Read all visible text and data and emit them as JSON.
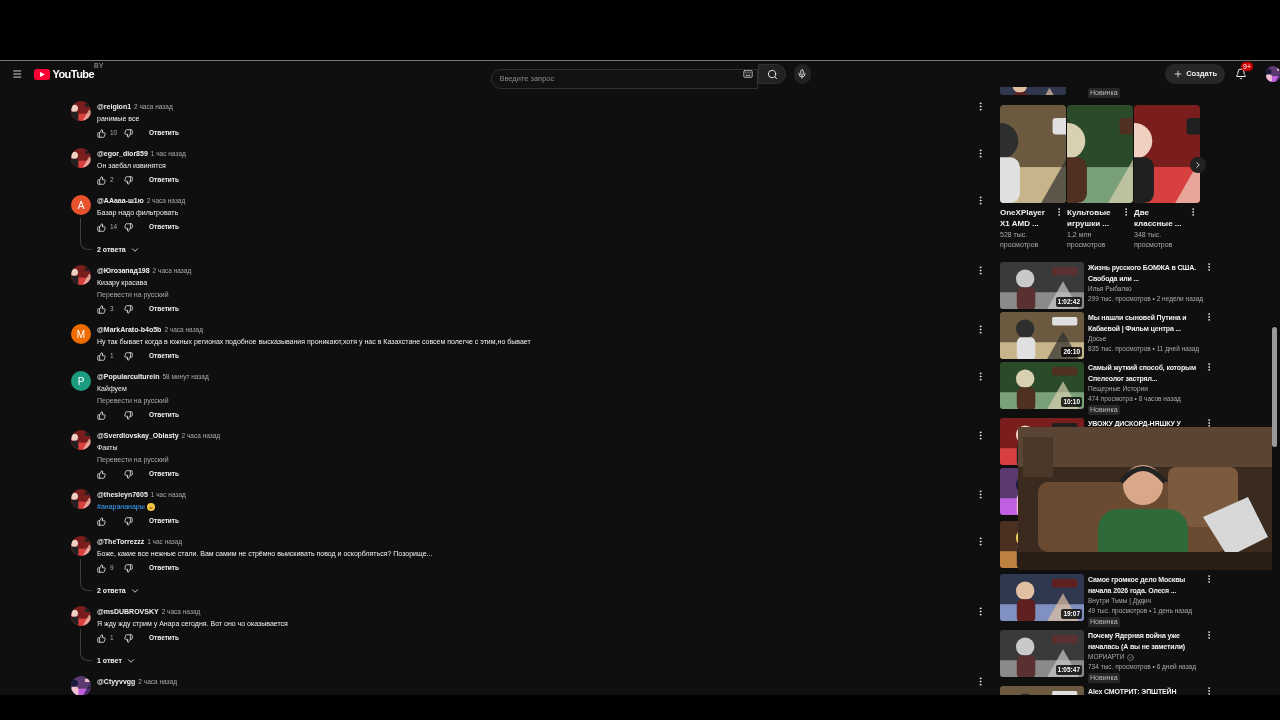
{
  "header": {
    "logo_text": "YouTube",
    "region": "BY",
    "search": {
      "placeholder": "Введите запрос"
    },
    "create_label": "Создать",
    "notifications_badge": "9+"
  },
  "comments": [
    {
      "author": "@reigion1",
      "time": "2 часа назад",
      "text": "ранимые все",
      "likes": "10",
      "reply_label": "Ответить"
    },
    {
      "author": "@egor_dior859",
      "time": "1 час назад",
      "text": "Он заебал извинятся",
      "likes": "2",
      "reply_label": "Ответить"
    },
    {
      "author": "@AAaaa-ш1ю",
      "time": "2 часа назад",
      "text": "Базар надо фильтровать",
      "likes": "14",
      "reply_label": "Ответить",
      "replies_label": "2 ответа",
      "avatar": {
        "kind": "letter",
        "letter": "A",
        "color": "#e8532e"
      }
    },
    {
      "author": "@Югозапад198",
      "time": "2 часа назад",
      "text": "Кизару красава",
      "translate": "Перевести на русский",
      "likes": "3",
      "reply_label": "Ответить"
    },
    {
      "author": "@MarkArato-b4o5b",
      "time": "2 часа назад",
      "text": "Ну так бывает когда в южных регионах подобное высказывания проникают,хотя у нас в Казахстане совсем полегче с этим,но бывает",
      "likes": "1",
      "reply_label": "Ответить",
      "avatar": {
        "kind": "letter",
        "letter": "M",
        "color": "#ef6c00"
      }
    },
    {
      "author": "@Popularculturein",
      "time": "58 минут назад",
      "text": "Кайфуем",
      "translate": "Перевести на русский",
      "reply_label": "Ответить",
      "avatar": {
        "kind": "letter",
        "letter": "P",
        "color": "#1b9b80"
      }
    },
    {
      "author": "@Sverdlovskay_Oblasty",
      "time": "2 часа назад",
      "text": "Факты",
      "translate": "Перевести на русский",
      "reply_label": "Ответить"
    },
    {
      "author": "@thesieyn7605",
      "time": "1 час назад",
      "text": "#анарананары",
      "hashtag": true,
      "emoji": true,
      "reply_label": "Ответить"
    },
    {
      "author": "@TheTorrezzz",
      "time": "1 час назад",
      "text": "Боже, какие все нежные стали. Вам самим не стрёмно выискивать повод и оскорбляться? Позорище...",
      "likes": "9",
      "reply_label": "Ответить",
      "replies_label": "2 ответа"
    },
    {
      "author": "@msDUBROVSKY",
      "time": "2 часа назад",
      "text": "Я жду жду стрим у Анара сегодня. Вот оно чо оказывается",
      "likes": "1",
      "reply_label": "Ответить",
      "replies_label": "1 ответ"
    },
    {
      "author": "@Ctyyvvgg",
      "time": "2 часа назад"
    }
  ],
  "sidebar": {
    "top_partial": {
      "badge": "Новинка"
    },
    "shorts": [
      {
        "title": "OneXPlayer X1 AMD ...",
        "views": "528 тыс. просмотров"
      },
      {
        "title": "Культовые игрушки ...",
        "views": "1,2 млн просмотров"
      },
      {
        "title": "Две классные ...",
        "views": "348 тыс. просмотров"
      }
    ],
    "videos": [
      {
        "kind": "video",
        "title": "Жизнь русского БОМЖА в США. Свобода или ...",
        "channel": "Илья Рыбалко",
        "meta": "299 тыс. просмотров • 2 недели назад",
        "duration": "1:02:42"
      },
      {
        "kind": "video",
        "title": "Мы нашли сыновей Путина и Кабаевой | Фильм центра ...",
        "channel": "Досье",
        "meta": "835 тыс. просмотров • 11 дней назад",
        "duration": "26:10"
      },
      {
        "kind": "video",
        "title": "Самый жуткий способ, которым Спелеолог застрял...",
        "channel": "Пещерные Истории",
        "meta": "474 просмотра • 8 часов назад",
        "duration": "10:10",
        "badge": "Новинка"
      },
      {
        "kind": "video",
        "title": "УВОЖУ ДИСКОРД-НЯШКУ У"
      },
      {
        "kind": "thumbnail_only"
      },
      {
        "kind": "thumbnail_only"
      },
      {
        "kind": "video",
        "title": "Самое громкое дело Москвы начала 2026 года. Олеся ...",
        "channel": "Внутри Тьмы | Дудич",
        "meta": "49 тыс. просмотров • 1 день назад",
        "duration": "19:07",
        "badge": "Новинка"
      },
      {
        "kind": "video",
        "title": "Почему Ядерная война уже началась (А вы не заметили)",
        "channel": "МОРИАРТИ",
        "verified": true,
        "meta": "734 тыс. просмотров • 6 дней назад",
        "duration": "1:05:47",
        "badge": "Новинка"
      },
      {
        "kind": "video",
        "title": "Alex СМОТРИТ: ЭПШТЕЙН"
      }
    ]
  }
}
